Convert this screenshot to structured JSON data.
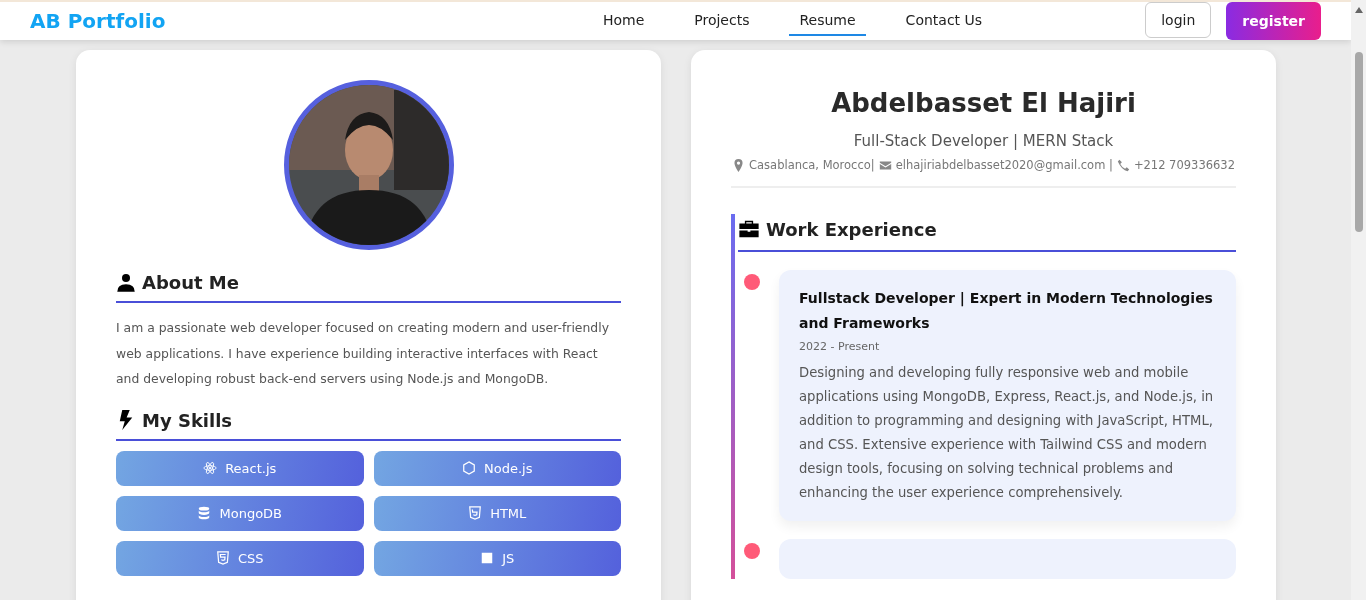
{
  "header": {
    "logo": "AB Portfolio",
    "nav": [
      {
        "label": "Home",
        "selected": false
      },
      {
        "label": "Projects",
        "selected": false
      },
      {
        "label": "Resume",
        "selected": true
      },
      {
        "label": "Contact Us",
        "selected": false
      }
    ],
    "login": "login",
    "register": "register"
  },
  "profile": {
    "about_title": "About Me",
    "about_text": "I am a passionate web developer focused on creating modern and user-friendly web applications. I have experience building interactive interfaces with React and developing robust back-end servers using Node.js and MongoDB.",
    "skills_title": "My Skills",
    "skills": [
      "React.js",
      "Node.js",
      "MongoDB",
      "HTML",
      "CSS",
      "JS"
    ]
  },
  "resume": {
    "name": "Abdelbasset El Hajiri",
    "role": "Full-Stack Developer | MERN Stack",
    "location": "Casablanca, Morocco|",
    "email": "elhajiriabdelbasset2020@gmail.com |",
    "phone": "+212 709336632",
    "section_title": "Work Experience",
    "jobs": [
      {
        "title": "Fullstack Developer | Expert in Modern Technologies and Frameworks",
        "period": "2022 - Present",
        "description": "Designing and developing fully responsive web and mobile applications using MongoDB, Express, React.js, and Node.js, in addition to programming and designing with JavaScript, HTML, and CSS. Extensive experience with Tailwind CSS and modern design tools, focusing on solving technical problems and enhancing the user experience comprehensively."
      },
      {
        "kind": "cut"
      }
    ]
  }
}
